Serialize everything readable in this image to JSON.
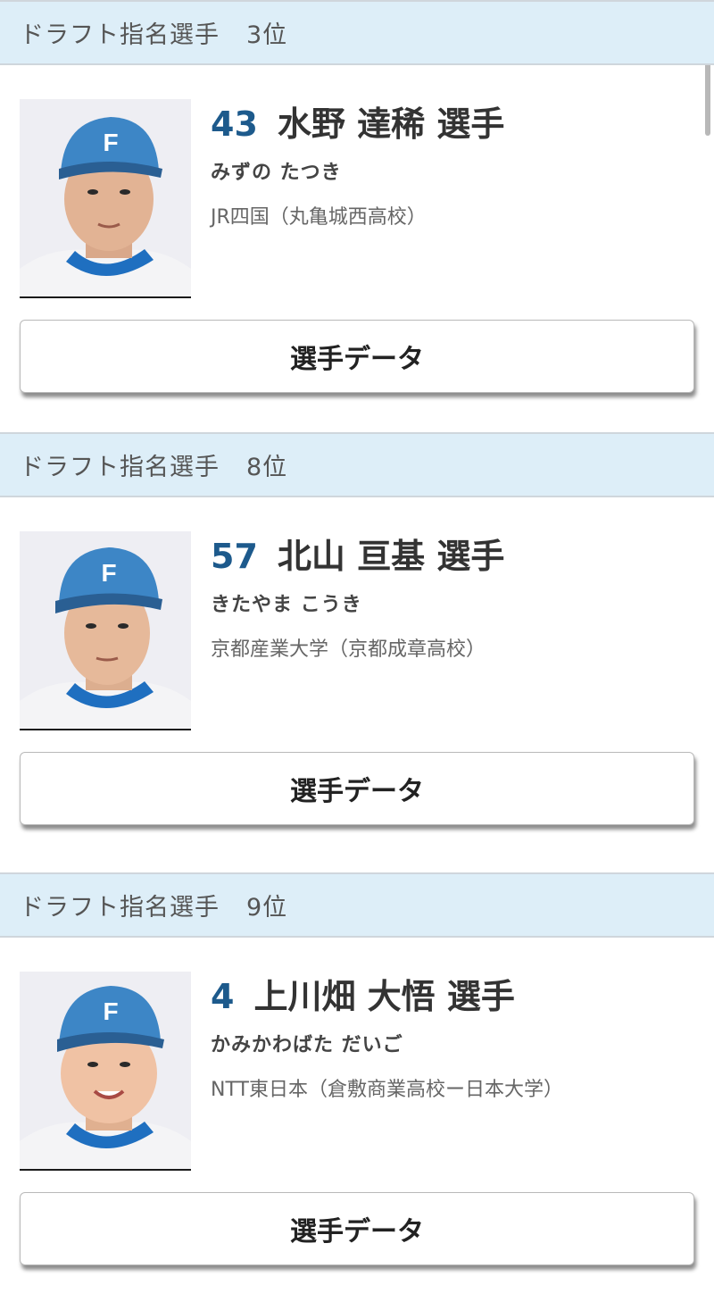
{
  "players": [
    {
      "header_label": "ドラフト指名選手",
      "rank": "3位",
      "number": "43",
      "name": "水野 達稀 選手",
      "kana": "みずの たつき",
      "school": "JR四国（丸亀城西高校）",
      "button_label": "選手データ"
    },
    {
      "header_label": "ドラフト指名選手",
      "rank": "8位",
      "number": "57",
      "name": "北山 亘基 選手",
      "kana": "きたやま こうき",
      "school": "京都産業大学（京都成章高校）",
      "button_label": "選手データ"
    },
    {
      "header_label": "ドラフト指名選手",
      "rank": "9位",
      "number": "4",
      "name": "上川畑 大悟 選手",
      "kana": "かみかわばた だいご",
      "school": "NTT東日本（倉敷商業高校ー日本大学）",
      "button_label": "選手データ"
    }
  ],
  "colors": {
    "header_bg": "#ddeef8",
    "number": "#1d5a8c",
    "cap": "#3d86c6",
    "cap_logo": "#ffffff"
  },
  "icons": [
    "player-photo",
    "scrollbar"
  ]
}
